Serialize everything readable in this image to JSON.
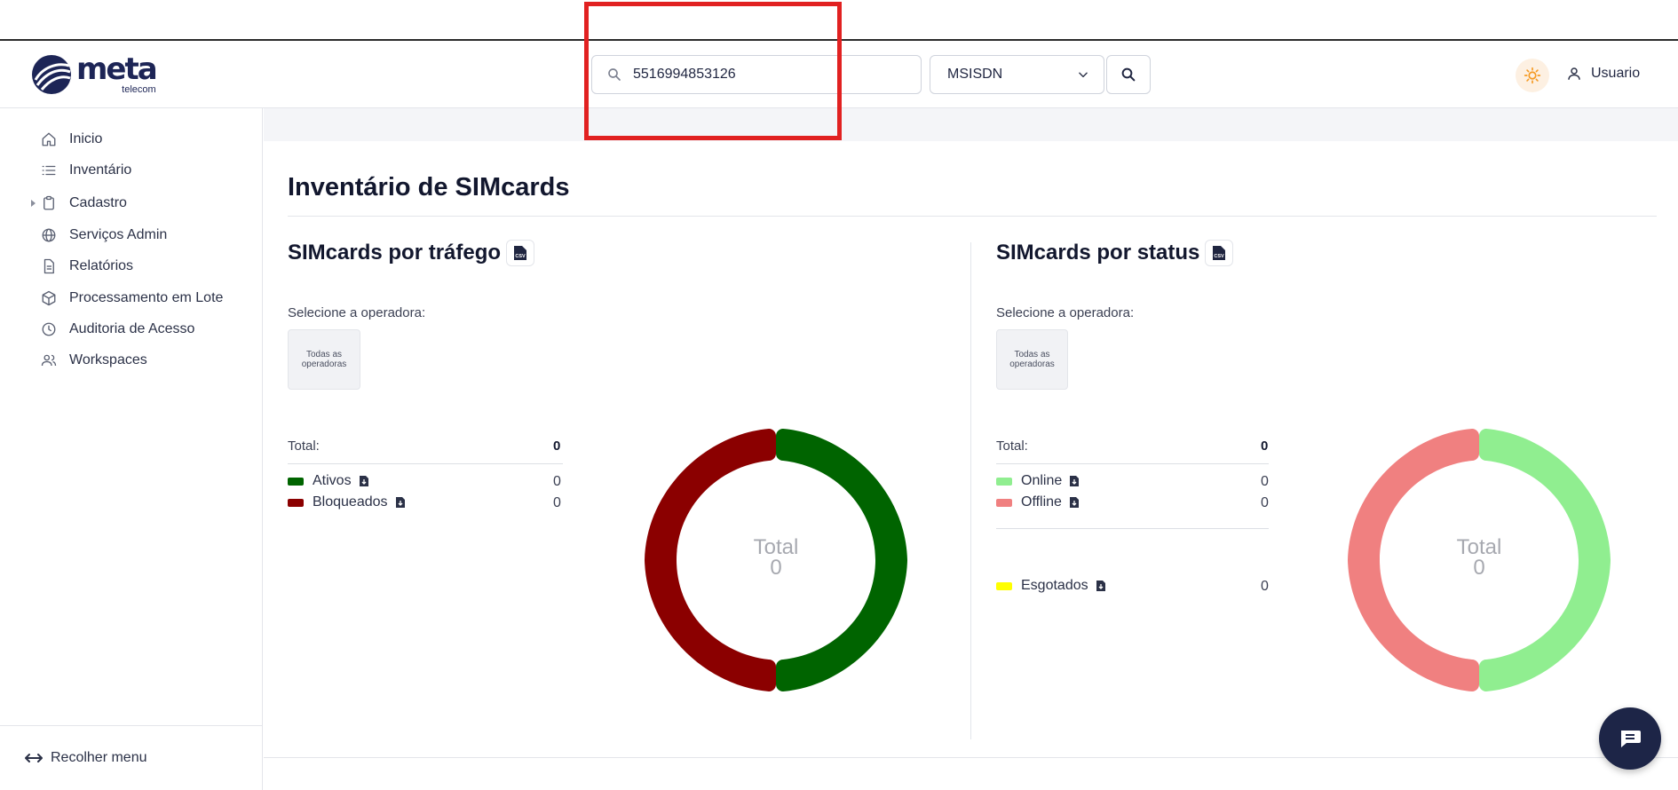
{
  "header": {
    "search_value": "5516994853126",
    "search_type": "MSISDN",
    "user_label": "Usuario",
    "logo": {
      "word": "meta",
      "sub": "telecom"
    }
  },
  "sidebar": {
    "items": [
      {
        "label": "Inicio",
        "icon": "home-icon"
      },
      {
        "label": "Inventário",
        "icon": "list-icon"
      },
      {
        "label": "Cadastro",
        "icon": "clipboard-icon"
      },
      {
        "label": "Serviços Admin",
        "icon": "globe-icon"
      },
      {
        "label": "Relatórios",
        "icon": "document-icon"
      },
      {
        "label": "Processamento em Lote",
        "icon": "box-icon"
      },
      {
        "label": "Auditoria de Acesso",
        "icon": "clock-icon"
      },
      {
        "label": "Workspaces",
        "icon": "users-icon"
      }
    ],
    "collapse_label": "Recolher menu"
  },
  "main": {
    "title": "Inventário de SIMcards",
    "traffic": {
      "title": "SIMcards por tráfego",
      "select_label": "Selecione a operadora:",
      "operator_button": "Todas as operadoras",
      "total_label": "Total:",
      "total_value": "0",
      "legend": [
        {
          "label": "Ativos",
          "value": "0",
          "color": "#006400"
        },
        {
          "label": "Bloqueados",
          "value": "0",
          "color": "#8b0000"
        }
      ],
      "center_label": "Total",
      "center_value": "0"
    },
    "status": {
      "title": "SIMcards por status",
      "select_label": "Selecione a operadora:",
      "operator_button": "Todas as operadoras",
      "total_label": "Total:",
      "total_value": "0",
      "legend": [
        {
          "label": "Online",
          "value": "0",
          "color": "#90ee90"
        },
        {
          "label": "Offline",
          "value": "0",
          "color": "#f08080"
        }
      ],
      "extra": {
        "label": "Esgotados",
        "value": "0",
        "color": "#ffff00"
      },
      "center_label": "Total",
      "center_value": "0"
    }
  }
}
